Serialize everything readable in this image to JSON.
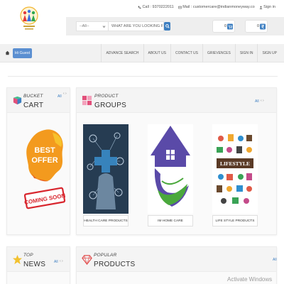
{
  "header": {
    "phone_text": "Call : 9370222011",
    "mail_text": "Mail : customercare@indianmoneyway.co",
    "signin_text": "Sign in"
  },
  "search": {
    "category_value": "--All--",
    "placeholder": "WHAT ARE YOU LOOKING FOR?",
    "cart_count": "0",
    "wishlist_count": "0"
  },
  "nav": {
    "greeting": "Hi Guest",
    "items": [
      "ADVANCE SEARCH",
      "ABOUT US",
      "CONTACT US",
      "GRIEVENCES",
      "SIGN IN",
      "SIGN UP"
    ]
  },
  "bucket": {
    "small": "BUCKET",
    "big": "CART",
    "all": "All",
    "promo_line1": "BEST",
    "promo_line2": "OFFER",
    "promo_line3": "COMING SOON"
  },
  "groups": {
    "small": "PRODUCT",
    "big": "GROUPS",
    "all": "All",
    "cards": [
      {
        "label": "HEALTH CARE PRODUCTS"
      },
      {
        "label": "IM HOME CARE"
      },
      {
        "label": "LIFE STYLE PRODUCTS"
      }
    ],
    "lifestyle_sign": "LIFESTYLE"
  },
  "news": {
    "small": "TOP",
    "big": "NEWS",
    "all": "All"
  },
  "popular": {
    "small": "POPULAR",
    "big": "PRODUCTS",
    "all": "All"
  },
  "watermark": "Activate Windows",
  "colors": {
    "accent_blue": "#3e7fc1",
    "guest_badge": "#5b8fd1",
    "offer_orange": "#f39a1e",
    "offer_red": "#d8262e",
    "home_purple": "#5a4aa8",
    "home_green": "#4aa83c"
  }
}
